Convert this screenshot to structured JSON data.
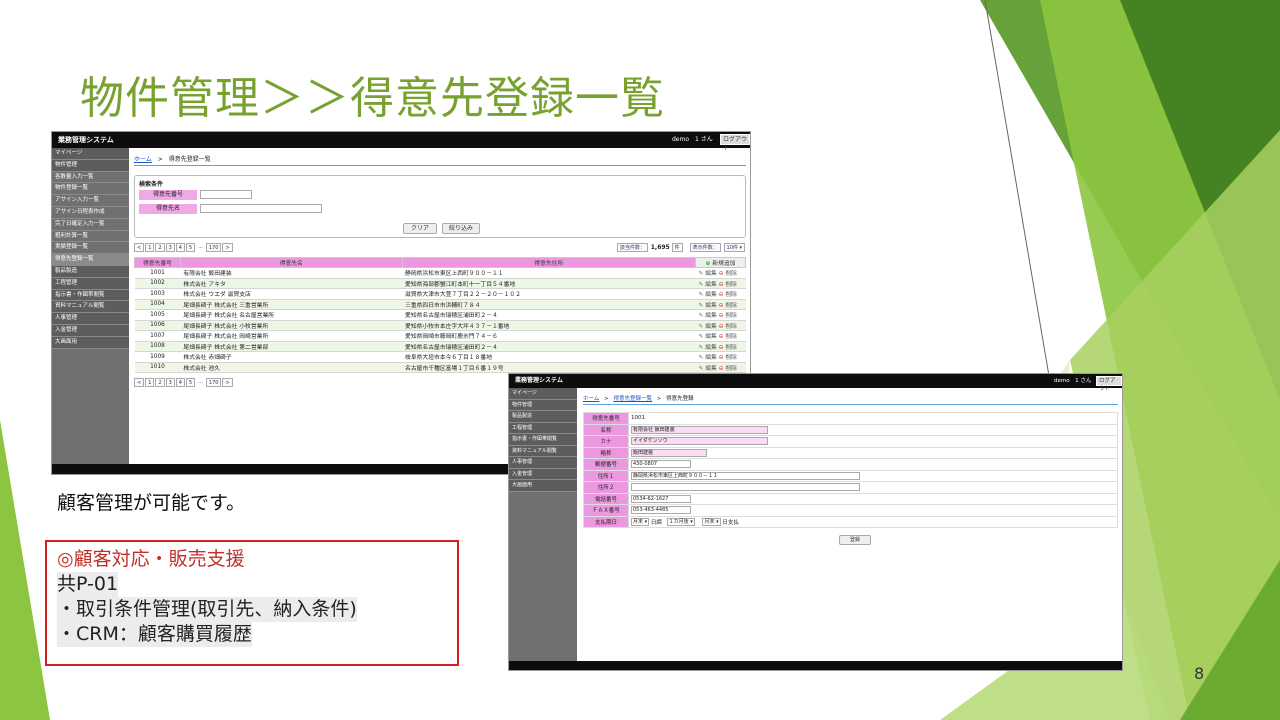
{
  "slide": {
    "title": "物件管理＞＞得意先登録一覧",
    "caption": "顧客管理が可能です。",
    "note_lines": [
      "◎顧客対応・販売支援",
      "共P-01",
      "・取引条件管理(取引先、納入条件)",
      "・CRM：顧客購買履歴"
    ],
    "page_number": "8",
    "colors": {
      "title": "#78a22f",
      "accent_green": "#8bc34a",
      "note_border": "#d21f1f",
      "table_header": "#ec98e0"
    }
  },
  "app_list": {
    "system_name": "業務管理システム",
    "user": "demo　1 さん",
    "logout": "ログアウト",
    "sidebar": [
      "マイページ",
      "物件管理",
      "各数量入力一覧",
      "物件登録一覧",
      "アサイン入力一覧",
      "アサイン日程表作成",
      "完了日確定入力一覧",
      "粗利計算一覧",
      "実績登録一覧",
      "得意先登録一覧",
      "製品製造",
      "工程管理",
      "指示書・作図帯閲覧",
      "資料マニュアル閲覧",
      "人事管理",
      "入金管理",
      "大画面用"
    ],
    "breadcrumb": {
      "home": "ホーム",
      "sep": ">",
      "current": "得意先登録一覧"
    },
    "search": {
      "title": "検索条件",
      "code_label": "得意先番号",
      "name_label": "得意先名",
      "clear": "クリア",
      "filter": "絞り込み"
    },
    "pager": {
      "pages": [
        "<",
        "1",
        "2",
        "3",
        "4",
        "5",
        "...",
        "170",
        ">"
      ],
      "total_label": "該当件数：",
      "total": "1,695",
      "unit": "件",
      "per_page_label": "表示件数：",
      "per_page": "10件 ▾"
    },
    "table": {
      "headers": [
        "得意先番号",
        "得意先名",
        "得意先住所"
      ],
      "new_label": "新規追加",
      "edit_label": "編集",
      "delete_label": "削除",
      "rows": [
        [
          "1001",
          "有限会社 飯田建装",
          "静岡県浜松市東区上西町９００－１１"
        ],
        [
          "1002",
          "株式会社 アキタ",
          "愛知県海部郡蟹江町本町十一丁目５４番地"
        ],
        [
          "1003",
          "株式会社 ウエダ 滋賀支店",
          "滋賀県大津市大萱７丁目２２－２０－１０２"
        ],
        [
          "1004",
          "尾畑長碕子 株式会社 三重営業所",
          "三重県四日市市浜輔町７８４"
        ],
        [
          "1005",
          "尾畑長碕子 株式会社 名古屋営業所",
          "愛知県名古屋市瑞穂区浦田町２－４"
        ],
        [
          "1006",
          "尾畑長碕子 株式会社 小牧営業所",
          "愛知県小牧市本庄字大坪４３７－１番地"
        ],
        [
          "1007",
          "尾畑長碕子 株式会社 岡崎営業所",
          "愛知県岡崎市藤岡町鹿氷門７４－６"
        ],
        [
          "1008",
          "尾畑長碕子 株式会社 第二営業部",
          "愛知県名古屋市瑞穂区浦田町２－４"
        ],
        [
          "1009",
          "株式会社 赤畑碕子",
          "岐阜県大垣市本今６丁目１８番地"
        ],
        [
          "1010",
          "株式会社 池久",
          "名古屋市千種区富場１丁目６番１９号"
        ]
      ]
    },
    "pager_bottom": [
      "<",
      "1",
      "2",
      "3",
      "4",
      "5",
      "...",
      "170",
      ">"
    ]
  },
  "app_form": {
    "system_name": "業務管理システム",
    "user": "demo　1 さん",
    "logout": "ログアウト",
    "sidebar": [
      "マイページ",
      "物件管理",
      "製品製造",
      "工程管理",
      "指示書・作図帯閲覧",
      "資料マニュアル閲覧",
      "人事管理",
      "入金管理",
      "大画面用"
    ],
    "breadcrumb": {
      "home": "ホーム",
      "sep1": ">",
      "list": "得意先登録一覧",
      "sep2": ">",
      "current": "得意先登録"
    },
    "fields": {
      "code_label": "得意先番号",
      "code": "1001",
      "name_label": "名称",
      "name": "有限会社 飯田建装",
      "kana_label": "カナ",
      "kana": "イイダケンソウ",
      "short_label": "略称",
      "short": "飯田建装",
      "zip_label": "郵便番号",
      "zip": "430-0807",
      "addr1_label": "住所１",
      "addr1": "静岡県浜松市東区上西町９００－１１",
      "addr2_label": "住所２",
      "addr2": "",
      "tel_label": "電話番号",
      "tel": "0534-62-1627",
      "fax_label": "ＦＡＸ番号",
      "fax": "053-463-4485",
      "pay_label": "支払期日",
      "pay_cutoff": "月末 ▾",
      "pay_cutoff_suffix": "日締",
      "pay_month": "１カ月後 ▾",
      "pay_day": "月末 ▾",
      "pay_day_suffix": "日支払"
    },
    "submit": "登録"
  }
}
